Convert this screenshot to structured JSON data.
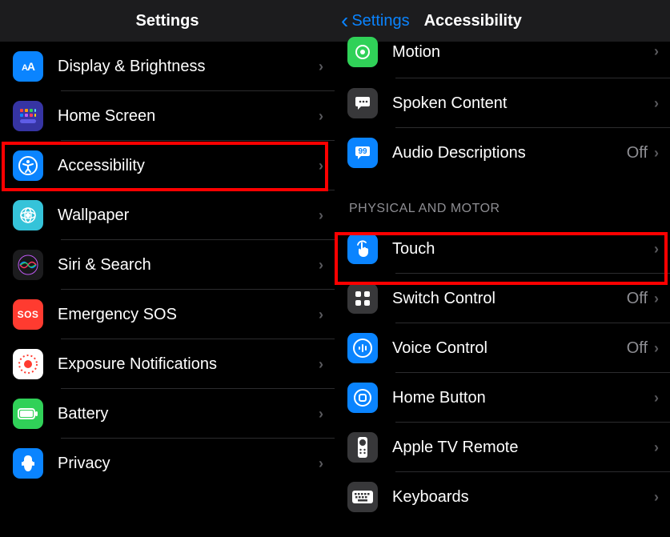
{
  "left": {
    "title": "Settings",
    "items": [
      {
        "icon": "display-icon",
        "label": "Display & Brightness",
        "bg": "#0a84ff",
        "glyph": "AA"
      },
      {
        "icon": "home-icon",
        "label": "Home Screen",
        "bg": "#3a3dcf",
        "glyph": "apps"
      },
      {
        "icon": "accessibility-icon",
        "label": "Accessibility",
        "bg": "#0a84ff",
        "glyph": "person"
      },
      {
        "icon": "wallpaper-icon",
        "label": "Wallpaper",
        "bg": "#3fc8de",
        "glyph": "flower"
      },
      {
        "icon": "siri-icon",
        "label": "Siri & Search",
        "bg": "#1c1c1e",
        "glyph": "siri"
      },
      {
        "icon": "sos-icon",
        "label": "Emergency SOS",
        "bg": "#ff3b30",
        "glyph": "SOS"
      },
      {
        "icon": "exposure-icon",
        "label": "Exposure Notifications",
        "bg": "#ffffff",
        "glyph": "dots"
      },
      {
        "icon": "battery-icon",
        "label": "Battery",
        "bg": "#30d158",
        "glyph": "battery"
      },
      {
        "icon": "privacy-icon",
        "label": "Privacy",
        "bg": "#0a84ff",
        "glyph": "hand"
      }
    ]
  },
  "right": {
    "back_label": "Settings",
    "title": "Accessibility",
    "partial_first": {
      "icon": "motion-icon",
      "label": "Motion",
      "bg": "#30d158",
      "glyph": "motion"
    },
    "top_items": [
      {
        "icon": "spoken-icon",
        "label": "Spoken Content",
        "bg": "#38383a",
        "glyph": "speech"
      },
      {
        "icon": "audio-desc-icon",
        "label": "Audio Descriptions",
        "bg": "#0a84ff",
        "glyph": "quote",
        "value": "Off"
      }
    ],
    "section_header": "PHYSICAL AND MOTOR",
    "motor_items": [
      {
        "icon": "touch-icon",
        "label": "Touch",
        "bg": "#0a84ff",
        "glyph": "tap"
      },
      {
        "icon": "switch-icon",
        "label": "Switch Control",
        "bg": "#38383a",
        "glyph": "grid4",
        "value": "Off"
      },
      {
        "icon": "voice-icon",
        "label": "Voice Control",
        "bg": "#0a84ff",
        "glyph": "voice",
        "value": "Off"
      },
      {
        "icon": "home-button-icon",
        "label": "Home Button",
        "bg": "#0a84ff",
        "glyph": "homebtn"
      },
      {
        "icon": "appletv-icon",
        "label": "Apple TV Remote",
        "bg": "#38383a",
        "glyph": "remote"
      },
      {
        "icon": "keyboards-icon",
        "label": "Keyboards",
        "bg": "#38383a",
        "glyph": "keyboard"
      }
    ]
  }
}
